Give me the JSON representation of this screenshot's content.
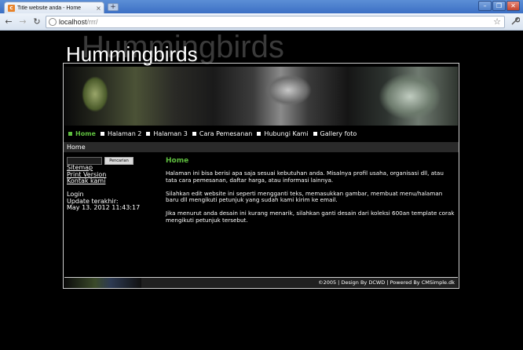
{
  "browser": {
    "tab_title": "Title website anda - Home",
    "tab_close": "×",
    "new_tab": "+",
    "favicon_letter": "c",
    "window_buttons": [
      "–",
      "❐",
      "✕"
    ],
    "nav": {
      "back": "←",
      "forward": "→",
      "reload": "↻"
    },
    "url_host": "localhost",
    "url_path": "/rrr/",
    "star": "☆",
    "wrench": "🔧"
  },
  "site": {
    "logo_text": "Hummingbirds",
    "logo_shadow_text": "Hummingbirds",
    "accent_color": "#5fbf3f"
  },
  "menu": {
    "items": [
      {
        "label": "Home",
        "active": true
      },
      {
        "label": "Halaman 2",
        "active": false
      },
      {
        "label": "Halaman 3",
        "active": false
      },
      {
        "label": "Cara Pemesanan",
        "active": false
      },
      {
        "label": "Hubungi Kami",
        "active": false
      },
      {
        "label": "Gallery foto",
        "active": false
      }
    ]
  },
  "breadcrumb": "Home",
  "sidebar": {
    "search_placeholder": "",
    "search_button": "Pencarian",
    "links": [
      "Sitemap",
      "Print Version",
      "Kontak kami"
    ],
    "login_label": "Login",
    "update_label": "Update terakhir:",
    "update_date": "May 13. 2012 11:43:17"
  },
  "content": {
    "title": "Home",
    "paragraphs": [
      "Halaman ini bisa berisi apa saja sesuai kebutuhan anda. Misalnya profil usaha, organisasi dll, atau tata cara pemesanan, daftar harga, atau informasi lainnya.",
      "Silahkan edit website ini seperti mengganti teks, memasukkan gambar, membuat menu/halaman baru dll mengikuti petunjuk yang sudah kami kirim ke email.",
      "Jika menurut anda desain ini kurang menarik, silahkan ganti desain dari koleksi 600an template corak mengikuti petunjuk tersebut."
    ]
  },
  "footer": {
    "text": "©2005 | Design By DCWD | Powered By CMSimple.dk"
  }
}
